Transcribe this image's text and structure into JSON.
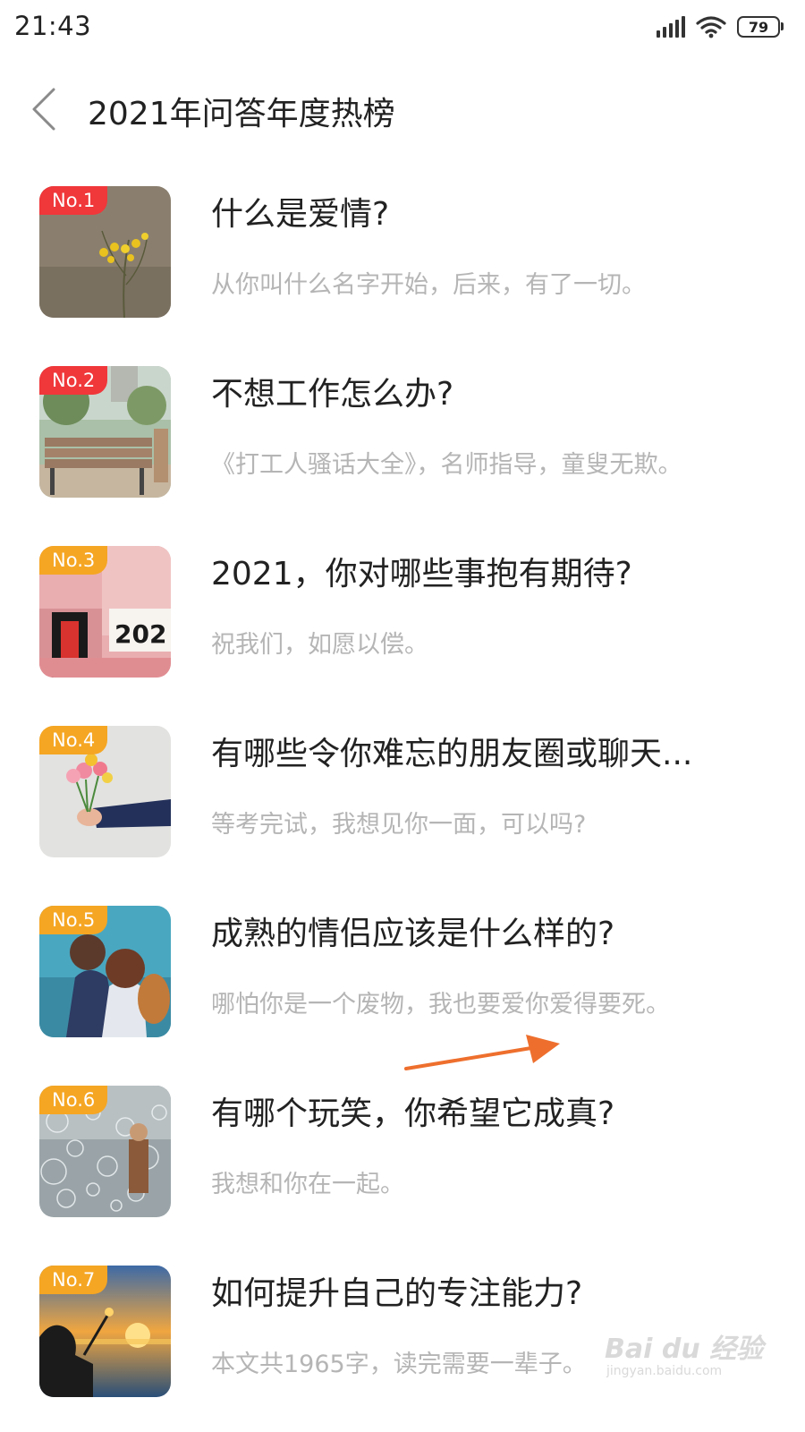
{
  "status_bar": {
    "time": "21:43",
    "battery": "79",
    "icons": [
      "signal-icon",
      "wifi-icon",
      "battery-icon"
    ]
  },
  "header": {
    "back_icon": "chevron-left-icon",
    "title": "2021年问答年度热榜"
  },
  "colors": {
    "rank_red": "#f0373a",
    "rank_orange": "#f5a623",
    "subtitle_gray": "#b5b5b5",
    "arrow_orange": "#ee6f2d"
  },
  "items": [
    {
      "rank": "No.1",
      "title": "什么是爱情?",
      "subtitle": "从你叫什么名字开始，后来，有了一切。",
      "badge": "red"
    },
    {
      "rank": "No.2",
      "title": "不想工作怎么办?",
      "subtitle": "《打工人骚话大全》，名师指导，童叟无欺。",
      "badge": "red"
    },
    {
      "rank": "No.3",
      "title": "2021，你对哪些事抱有期待?",
      "subtitle": "祝我们，如愿以偿。",
      "badge": "orange"
    },
    {
      "rank": "No.4",
      "title": "有哪些令你难忘的朋友圈或聊天...",
      "subtitle": "等考完试，我想见你一面，可以吗?",
      "badge": "orange"
    },
    {
      "rank": "No.5",
      "title": "成熟的情侣应该是什么样的?",
      "subtitle": "哪怕你是一个废物，我也要爱你爱得要死。",
      "badge": "orange"
    },
    {
      "rank": "No.6",
      "title": "有哪个玩笑，你希望它成真?",
      "subtitle": "我想和你在一起。",
      "badge": "orange"
    },
    {
      "rank": "No.7",
      "title": "如何提升自己的专注能力?",
      "subtitle": "本文共1965字，读完需要一辈子。",
      "badge": "orange"
    }
  ],
  "watermark": {
    "text": "Bai du 经验",
    "sub": "jingyan.baidu.com"
  }
}
